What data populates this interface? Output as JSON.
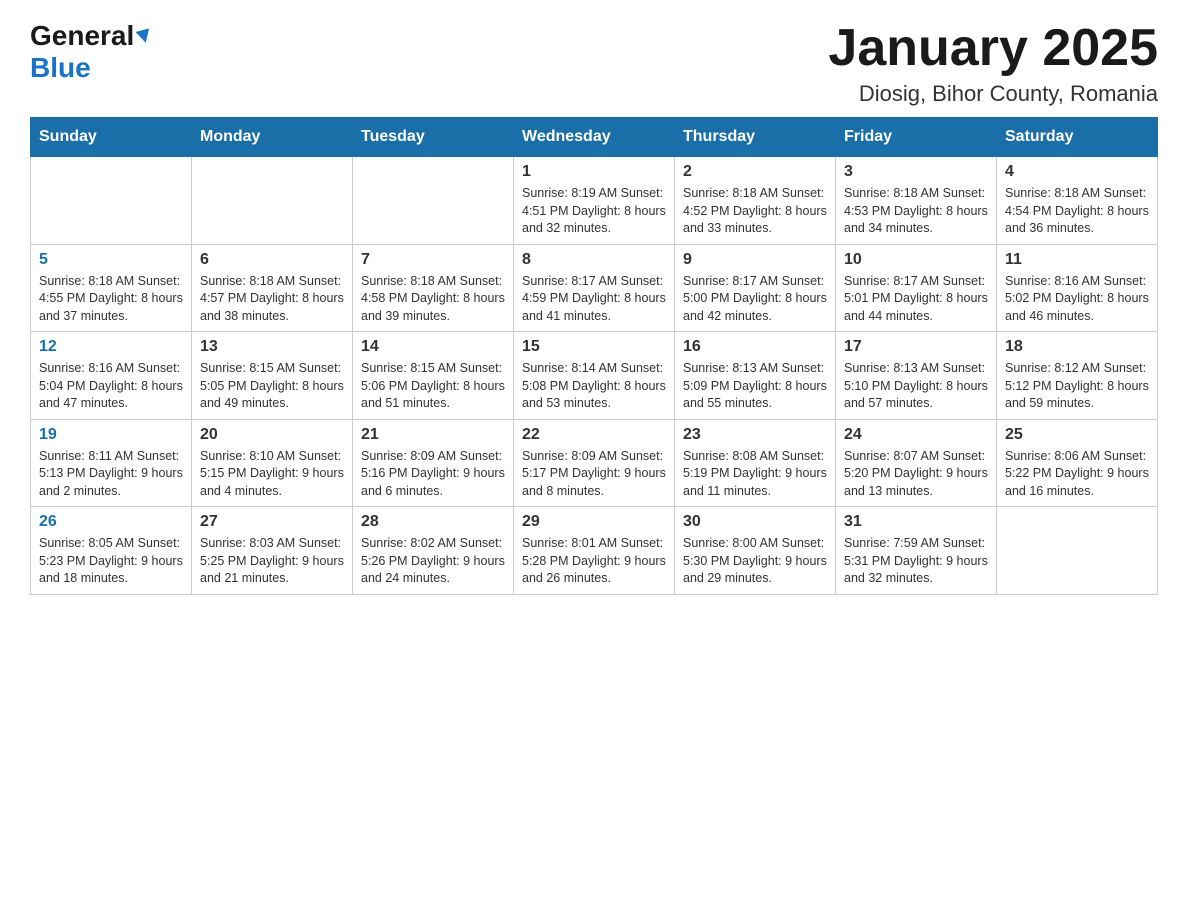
{
  "header": {
    "logo_general": "General",
    "logo_blue": "Blue",
    "title": "January 2025",
    "location": "Diosig, Bihor County, Romania"
  },
  "calendar": {
    "days": [
      "Sunday",
      "Monday",
      "Tuesday",
      "Wednesday",
      "Thursday",
      "Friday",
      "Saturday"
    ],
    "weeks": [
      [
        {
          "day": "",
          "info": ""
        },
        {
          "day": "",
          "info": ""
        },
        {
          "day": "",
          "info": ""
        },
        {
          "day": "1",
          "info": "Sunrise: 8:19 AM\nSunset: 4:51 PM\nDaylight: 8 hours\nand 32 minutes."
        },
        {
          "day": "2",
          "info": "Sunrise: 8:18 AM\nSunset: 4:52 PM\nDaylight: 8 hours\nand 33 minutes."
        },
        {
          "day": "3",
          "info": "Sunrise: 8:18 AM\nSunset: 4:53 PM\nDaylight: 8 hours\nand 34 minutes."
        },
        {
          "day": "4",
          "info": "Sunrise: 8:18 AM\nSunset: 4:54 PM\nDaylight: 8 hours\nand 36 minutes."
        }
      ],
      [
        {
          "day": "5",
          "info": "Sunrise: 8:18 AM\nSunset: 4:55 PM\nDaylight: 8 hours\nand 37 minutes."
        },
        {
          "day": "6",
          "info": "Sunrise: 8:18 AM\nSunset: 4:57 PM\nDaylight: 8 hours\nand 38 minutes."
        },
        {
          "day": "7",
          "info": "Sunrise: 8:18 AM\nSunset: 4:58 PM\nDaylight: 8 hours\nand 39 minutes."
        },
        {
          "day": "8",
          "info": "Sunrise: 8:17 AM\nSunset: 4:59 PM\nDaylight: 8 hours\nand 41 minutes."
        },
        {
          "day": "9",
          "info": "Sunrise: 8:17 AM\nSunset: 5:00 PM\nDaylight: 8 hours\nand 42 minutes."
        },
        {
          "day": "10",
          "info": "Sunrise: 8:17 AM\nSunset: 5:01 PM\nDaylight: 8 hours\nand 44 minutes."
        },
        {
          "day": "11",
          "info": "Sunrise: 8:16 AM\nSunset: 5:02 PM\nDaylight: 8 hours\nand 46 minutes."
        }
      ],
      [
        {
          "day": "12",
          "info": "Sunrise: 8:16 AM\nSunset: 5:04 PM\nDaylight: 8 hours\nand 47 minutes."
        },
        {
          "day": "13",
          "info": "Sunrise: 8:15 AM\nSunset: 5:05 PM\nDaylight: 8 hours\nand 49 minutes."
        },
        {
          "day": "14",
          "info": "Sunrise: 8:15 AM\nSunset: 5:06 PM\nDaylight: 8 hours\nand 51 minutes."
        },
        {
          "day": "15",
          "info": "Sunrise: 8:14 AM\nSunset: 5:08 PM\nDaylight: 8 hours\nand 53 minutes."
        },
        {
          "day": "16",
          "info": "Sunrise: 8:13 AM\nSunset: 5:09 PM\nDaylight: 8 hours\nand 55 minutes."
        },
        {
          "day": "17",
          "info": "Sunrise: 8:13 AM\nSunset: 5:10 PM\nDaylight: 8 hours\nand 57 minutes."
        },
        {
          "day": "18",
          "info": "Sunrise: 8:12 AM\nSunset: 5:12 PM\nDaylight: 8 hours\nand 59 minutes."
        }
      ],
      [
        {
          "day": "19",
          "info": "Sunrise: 8:11 AM\nSunset: 5:13 PM\nDaylight: 9 hours\nand 2 minutes."
        },
        {
          "day": "20",
          "info": "Sunrise: 8:10 AM\nSunset: 5:15 PM\nDaylight: 9 hours\nand 4 minutes."
        },
        {
          "day": "21",
          "info": "Sunrise: 8:09 AM\nSunset: 5:16 PM\nDaylight: 9 hours\nand 6 minutes."
        },
        {
          "day": "22",
          "info": "Sunrise: 8:09 AM\nSunset: 5:17 PM\nDaylight: 9 hours\nand 8 minutes."
        },
        {
          "day": "23",
          "info": "Sunrise: 8:08 AM\nSunset: 5:19 PM\nDaylight: 9 hours\nand 11 minutes."
        },
        {
          "day": "24",
          "info": "Sunrise: 8:07 AM\nSunset: 5:20 PM\nDaylight: 9 hours\nand 13 minutes."
        },
        {
          "day": "25",
          "info": "Sunrise: 8:06 AM\nSunset: 5:22 PM\nDaylight: 9 hours\nand 16 minutes."
        }
      ],
      [
        {
          "day": "26",
          "info": "Sunrise: 8:05 AM\nSunset: 5:23 PM\nDaylight: 9 hours\nand 18 minutes."
        },
        {
          "day": "27",
          "info": "Sunrise: 8:03 AM\nSunset: 5:25 PM\nDaylight: 9 hours\nand 21 minutes."
        },
        {
          "day": "28",
          "info": "Sunrise: 8:02 AM\nSunset: 5:26 PM\nDaylight: 9 hours\nand 24 minutes."
        },
        {
          "day": "29",
          "info": "Sunrise: 8:01 AM\nSunset: 5:28 PM\nDaylight: 9 hours\nand 26 minutes."
        },
        {
          "day": "30",
          "info": "Sunrise: 8:00 AM\nSunset: 5:30 PM\nDaylight: 9 hours\nand 29 minutes."
        },
        {
          "day": "31",
          "info": "Sunrise: 7:59 AM\nSunset: 5:31 PM\nDaylight: 9 hours\nand 32 minutes."
        },
        {
          "day": "",
          "info": ""
        }
      ]
    ]
  }
}
